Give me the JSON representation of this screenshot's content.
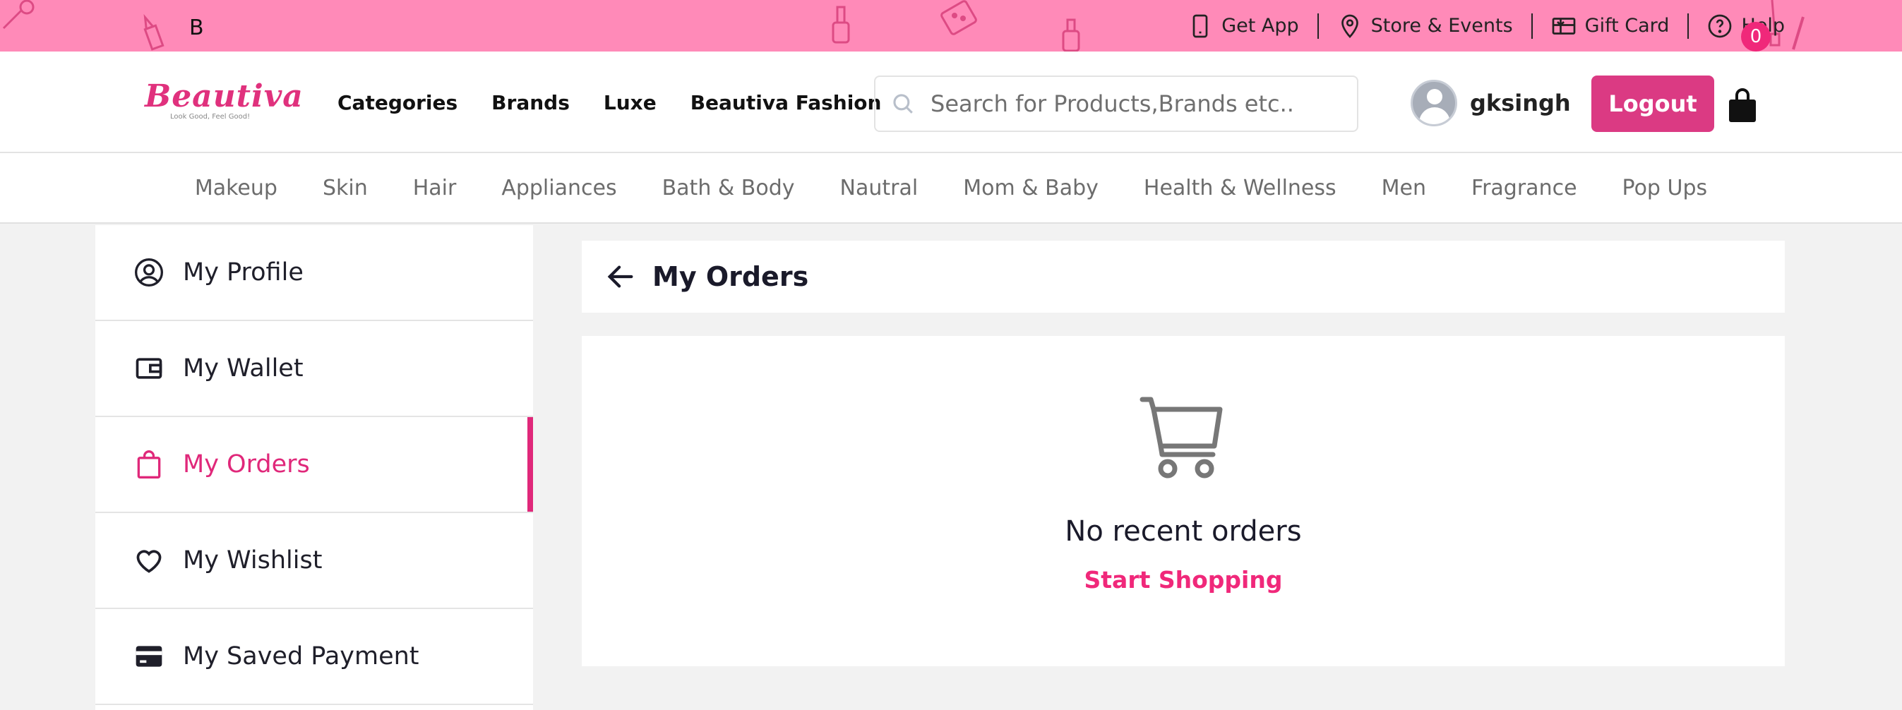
{
  "topbar": {
    "letter": "B",
    "links": [
      {
        "icon": "phone-icon",
        "label": "Get App"
      },
      {
        "icon": "location-pin-icon",
        "label": "Store & Events"
      },
      {
        "icon": "gift-card-icon",
        "label": "Gift Card"
      },
      {
        "icon": "help-circle-icon",
        "label": "Help"
      }
    ],
    "background_color": "#ff8ab8"
  },
  "header": {
    "logo_text": "Beautiva",
    "logo_tagline": "Look Good, Feel Good!",
    "nav": [
      "Categories",
      "Brands",
      "Luxe",
      "Beautiva Fashion"
    ],
    "search_placeholder": "Search for Products,Brands etc..",
    "username": "gksingh",
    "logout_label": "Logout",
    "cart_count": "0",
    "accent_color": "#db3a83"
  },
  "categories": [
    "Makeup",
    "Skin",
    "Hair",
    "Appliances",
    "Bath & Body",
    "Nautral",
    "Mom & Baby",
    "Health & Wellness",
    "Men",
    "Fragrance",
    "Pop Ups"
  ],
  "sidebar": {
    "items": [
      {
        "icon": "user-circle-icon",
        "label": "My Profile",
        "active": false
      },
      {
        "icon": "wallet-icon",
        "label": "My Wallet",
        "active": false
      },
      {
        "icon": "shopping-bag-icon",
        "label": "My Orders",
        "active": true
      },
      {
        "icon": "heart-icon",
        "label": "My Wishlist",
        "active": false
      },
      {
        "icon": "credit-card-icon",
        "label": "My Saved Payment",
        "active": false
      }
    ]
  },
  "main": {
    "title": "My Orders",
    "empty_message": "No recent orders",
    "cta_label": "Start Shopping"
  }
}
